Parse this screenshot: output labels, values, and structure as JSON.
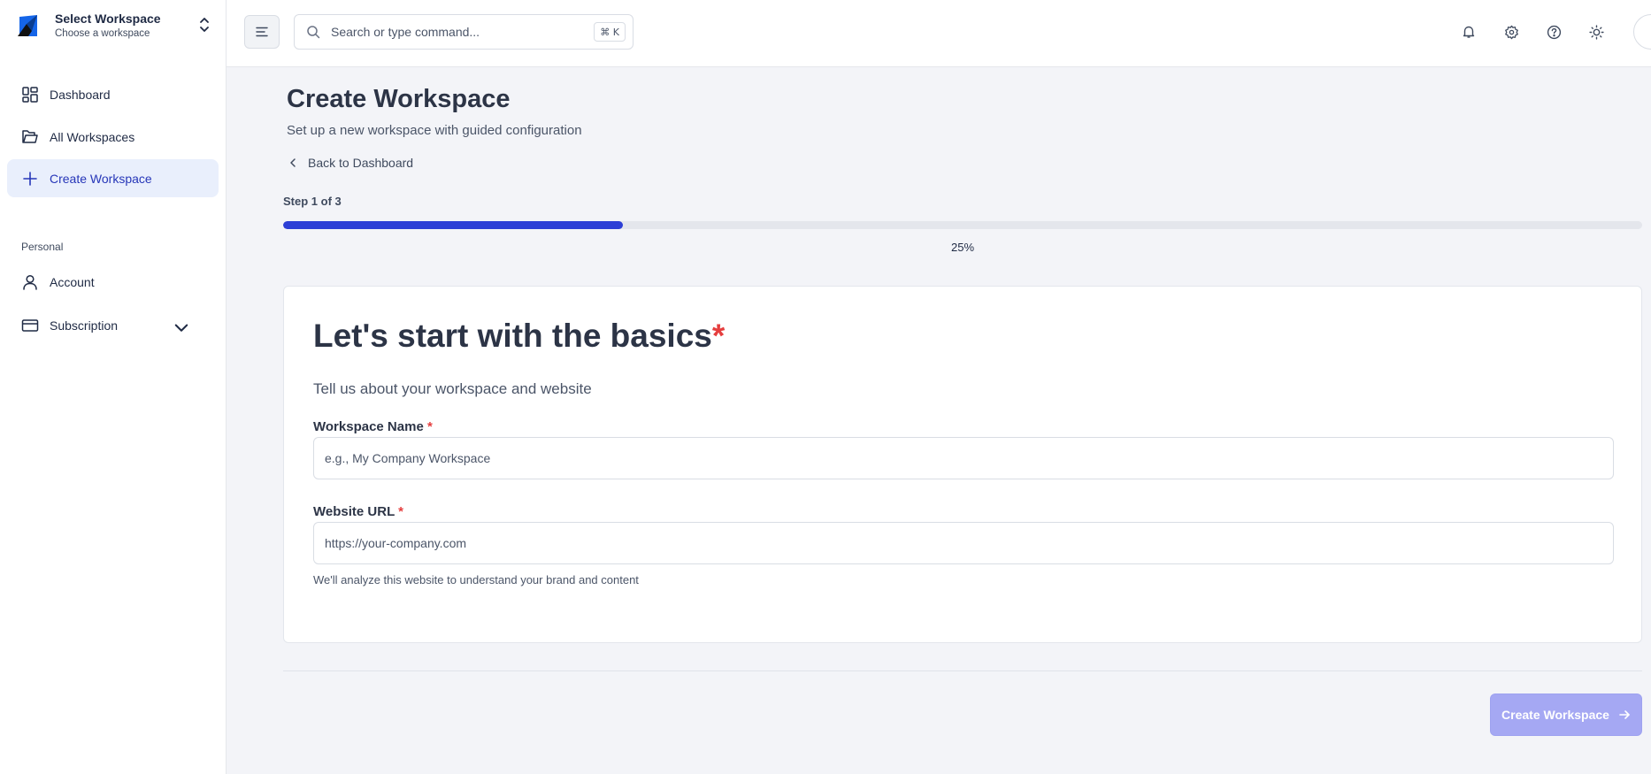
{
  "workspace_switcher": {
    "title": "Select Workspace",
    "subtitle": "Choose a workspace"
  },
  "sidebar": {
    "items": [
      {
        "label": "Dashboard",
        "icon": "dashboard-icon"
      },
      {
        "label": "All Workspaces",
        "icon": "folder-icon"
      },
      {
        "label": "Create Workspace",
        "icon": "plus-icon",
        "active": true
      }
    ],
    "personal_label": "Personal",
    "personal_items": [
      {
        "label": "Account",
        "icon": "user-icon"
      },
      {
        "label": "Subscription",
        "icon": "credit-card-icon",
        "expandable": true
      }
    ]
  },
  "topbar": {
    "search_placeholder": "Search or type command...",
    "shortcut": "⌘ K",
    "icons": [
      "bell-icon",
      "gear-icon",
      "help-icon",
      "sun-icon"
    ]
  },
  "main": {
    "title": "Create Workspace",
    "subtitle": "Set up a new workspace with guided configuration",
    "back_label": "Back to Dashboard",
    "step_label": "Step 1 of 3",
    "progress_percent": 25,
    "progress_text": "25%"
  },
  "card": {
    "title": "Let's start with the basics",
    "required_mark": "*",
    "subtitle": "Tell us about your workspace and website",
    "fields": [
      {
        "label": "Workspace Name",
        "placeholder": "e.g., My Company Workspace",
        "value": ""
      },
      {
        "label": "Website URL",
        "placeholder": "https://your-company.com",
        "value": ""
      }
    ],
    "hint": "We'll analyze this website to understand your brand and content"
  },
  "actions": {
    "submit_label": "Create Workspace"
  },
  "colors": {
    "accent": "#2d3fd6",
    "active_nav_bg": "#e9effc",
    "required": "#e53e3e",
    "button_disabled": "#a5a8f3"
  }
}
